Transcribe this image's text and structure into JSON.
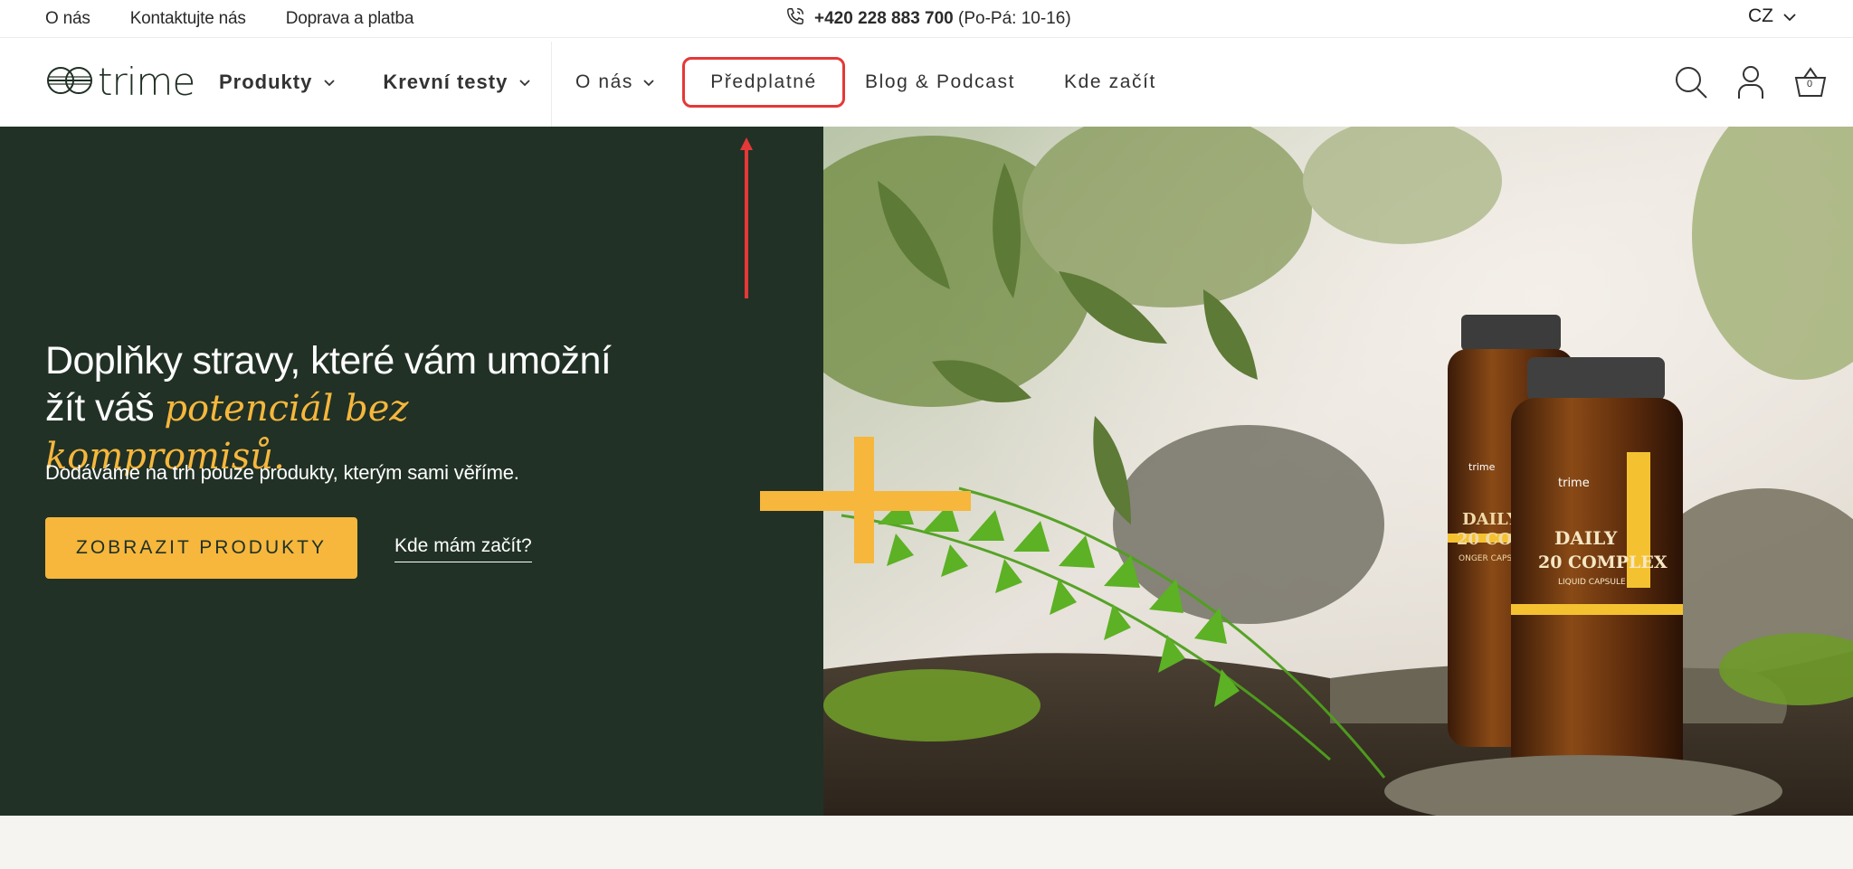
{
  "topbar": {
    "links": [
      "O nás",
      "Kontaktujte nás",
      "Doprava a platba"
    ],
    "phone_number": "+420 228 883 700",
    "phone_hours": "(Po-Pá: 10-16)",
    "language": "CZ"
  },
  "header": {
    "logo_text": "trime",
    "nav_left": [
      "Produkty",
      "Krevní testy"
    ],
    "nav_right": {
      "o_nas": "O nás",
      "predplatne": "Předplatné",
      "blog": "Blog & Podcast",
      "kde": "Kde začít"
    },
    "icons": [
      "search-icon",
      "account-icon",
      "basket-icon"
    ],
    "basket_count": "0"
  },
  "hero": {
    "headline_line1": "Doplňky stravy, které vám umožní",
    "headline_line2_plain": "žít váš ",
    "headline_emphasis": "potenciál bez kompromisů.",
    "subtext": "Dodáváme na trh pouze produkty, kterým sami věříme.",
    "cta_label": "ZOBRAZIT PRODUKTY",
    "secondary_link": "Kde mám začít?",
    "bottle_front_brand": "trime",
    "bottle_front_line1": "DAILY",
    "bottle_front_line2": "20 COMPLEX",
    "bottle_front_line3": "LIQUID CAPSULE",
    "bottle_back_line1": "DAILY",
    "bottle_back_line2": "20 COMP",
    "bottle_back_line3": "ONGER CAPSUL"
  },
  "colors": {
    "hero_green": "#213126",
    "accent_yellow": "#f6b73c",
    "highlight_red": "#e53838"
  }
}
